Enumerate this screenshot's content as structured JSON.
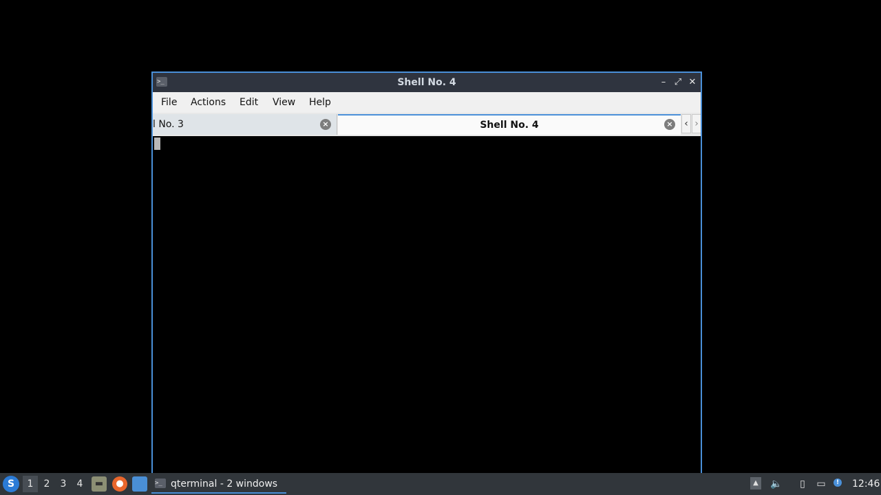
{
  "window": {
    "title": "Shell No. 4",
    "icon": "terminal-icon",
    "controls": {
      "minimize": "–",
      "maximize": "⤢",
      "close": "✕"
    }
  },
  "menubar": {
    "items": [
      {
        "label": "File"
      },
      {
        "label": "Actions"
      },
      {
        "label": "Edit"
      },
      {
        "label": "View"
      },
      {
        "label": "Help"
      }
    ]
  },
  "tabs": [
    {
      "label": "l No. 3",
      "active": false,
      "close_icon": "close-circle-icon"
    },
    {
      "label": "Shell No. 4",
      "active": true,
      "close_icon": "close-circle-icon"
    }
  ],
  "tab_scroll": {
    "left": "‹",
    "right": "›"
  },
  "terminal": {
    "content": "",
    "cursor": "block-cursor"
  },
  "taskbar": {
    "start_icon": "lxqt-start-icon",
    "desktops": [
      "1",
      "2",
      "3",
      "4"
    ],
    "active_desktop": "1",
    "launchers": [
      "file-manager-icon",
      "firefox-icon",
      "show-desktop-icon"
    ],
    "task": {
      "label": "qterminal - 2 windows",
      "icon": "terminal-icon"
    },
    "tray": [
      "tray-expand-icon",
      "volume-icon",
      "clipboard-icon",
      "network-icon",
      "update-notifier-icon"
    ],
    "clock": "12:46"
  },
  "colors": {
    "accent": "#4a90d9",
    "titlebar": "#2f343f",
    "taskbar": "#31363b",
    "terminal_bg": "#000000"
  }
}
